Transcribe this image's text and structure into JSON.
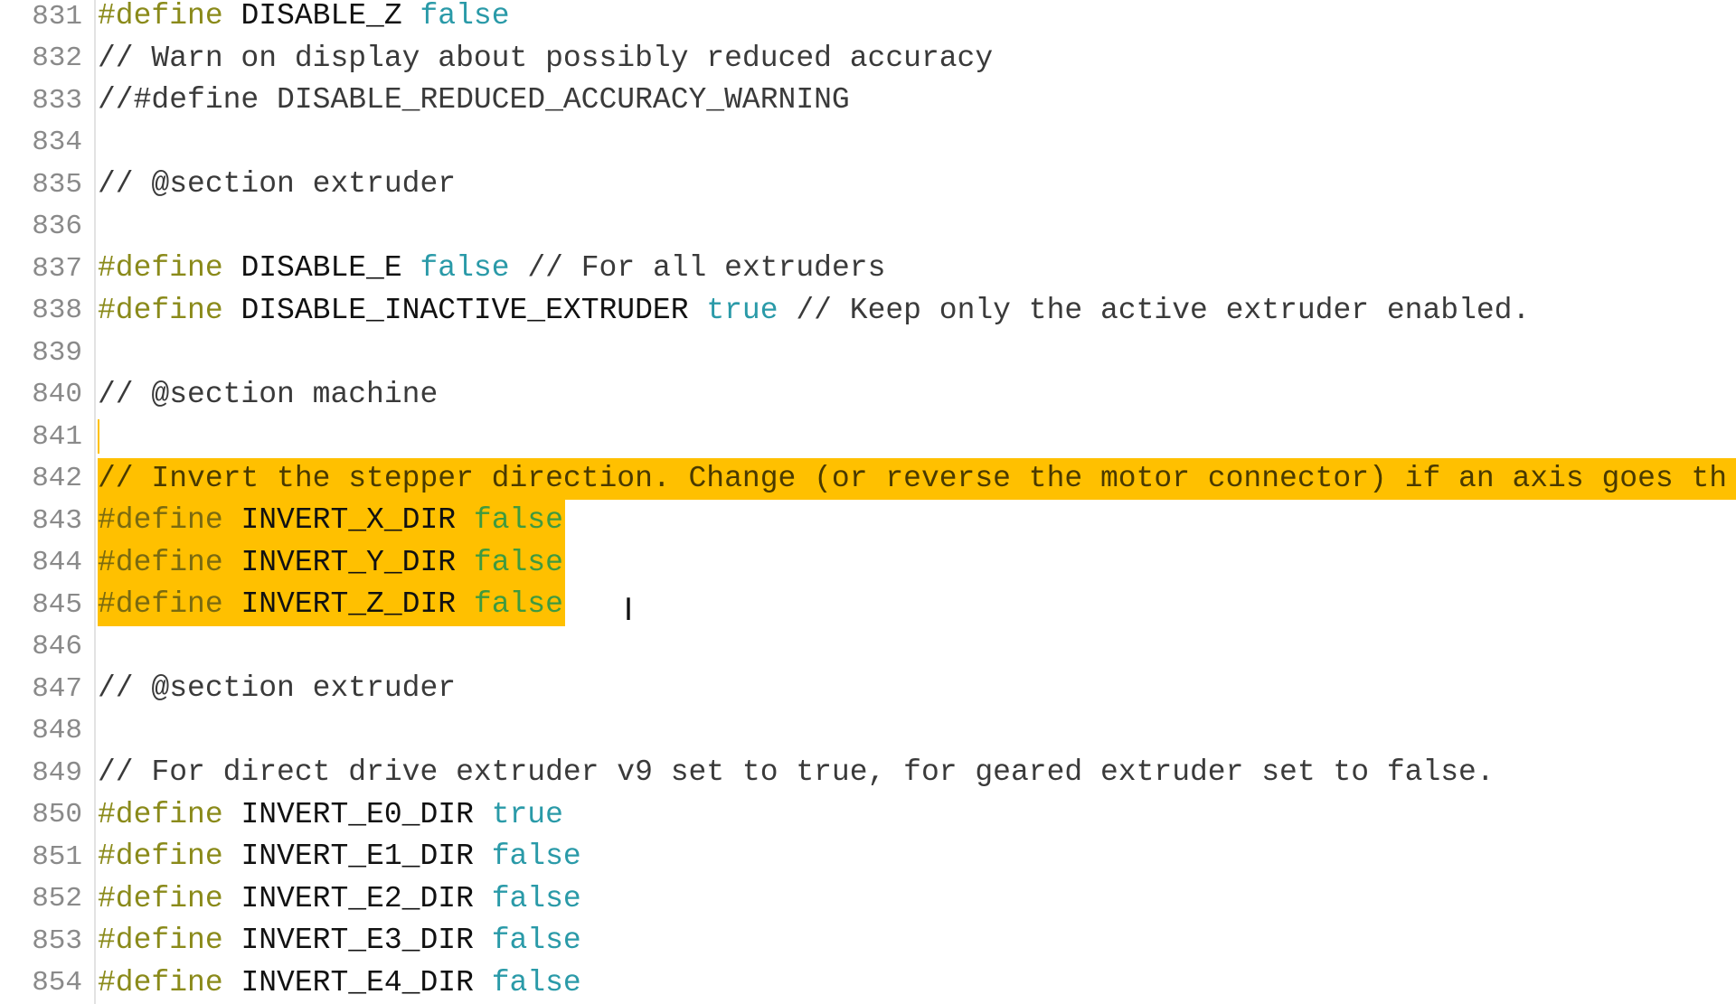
{
  "editor": {
    "selection_color": "#ffc000",
    "lines": [
      {
        "n": "831",
        "tokens": [
          {
            "t": "define",
            "v": "#define "
          },
          {
            "t": "ident",
            "v": "DISABLE_Z "
          },
          {
            "t": "bool",
            "v": "false"
          }
        ]
      },
      {
        "n": "832",
        "tokens": [
          {
            "t": "comment",
            "v": "// Warn on display about possibly reduced accuracy"
          }
        ]
      },
      {
        "n": "833",
        "tokens": [
          {
            "t": "comment",
            "v": "//#define DISABLE_REDUCED_ACCURACY_WARNING"
          }
        ]
      },
      {
        "n": "834",
        "tokens": []
      },
      {
        "n": "835",
        "tokens": [
          {
            "t": "comment",
            "v": "// @section extruder"
          }
        ]
      },
      {
        "n": "836",
        "tokens": []
      },
      {
        "n": "837",
        "tokens": [
          {
            "t": "define",
            "v": "#define "
          },
          {
            "t": "ident",
            "v": "DISABLE_E "
          },
          {
            "t": "bool",
            "v": "false"
          },
          {
            "t": "comment",
            "v": " // For all extruders"
          }
        ]
      },
      {
        "n": "838",
        "tokens": [
          {
            "t": "define",
            "v": "#define "
          },
          {
            "t": "ident",
            "v": "DISABLE_INACTIVE_EXTRUDER "
          },
          {
            "t": "bool",
            "v": "true"
          },
          {
            "t": "comment",
            "v": " // Keep only the active extruder enabled."
          }
        ]
      },
      {
        "n": "839",
        "tokens": []
      },
      {
        "n": "840",
        "tokens": [
          {
            "t": "comment",
            "v": "// @section machine"
          }
        ]
      },
      {
        "n": "841",
        "tokens": [],
        "caret": true
      },
      {
        "n": "842",
        "sel": "full",
        "tokens": [
          {
            "t": "comment",
            "v": "// Invert the stepper direction. Change (or reverse the motor connector) if an axis goes th"
          }
        ]
      },
      {
        "n": "843",
        "sel": "text",
        "tokens": [
          {
            "t": "define",
            "v": "#define "
          },
          {
            "t": "ident",
            "v": "INVERT_X_DIR "
          },
          {
            "t": "bool",
            "v": "false"
          }
        ]
      },
      {
        "n": "844",
        "sel": "text",
        "tokens": [
          {
            "t": "define",
            "v": "#define "
          },
          {
            "t": "ident",
            "v": "INVERT_Y_DIR "
          },
          {
            "t": "bool",
            "v": "false"
          }
        ]
      },
      {
        "n": "845",
        "sel": "text",
        "tokens": [
          {
            "t": "define",
            "v": "#define "
          },
          {
            "t": "ident",
            "v": "INVERT_Z_DIR "
          },
          {
            "t": "bool",
            "v": "false"
          }
        ]
      },
      {
        "n": "846",
        "tokens": []
      },
      {
        "n": "847",
        "tokens": [
          {
            "t": "comment",
            "v": "// @section extruder"
          }
        ]
      },
      {
        "n": "848",
        "tokens": []
      },
      {
        "n": "849",
        "tokens": [
          {
            "t": "comment",
            "v": "// For direct drive extruder v9 set to true, for geared extruder set to false."
          }
        ]
      },
      {
        "n": "850",
        "tokens": [
          {
            "t": "define",
            "v": "#define "
          },
          {
            "t": "ident",
            "v": "INVERT_E0_DIR "
          },
          {
            "t": "bool",
            "v": "true"
          }
        ]
      },
      {
        "n": "851",
        "tokens": [
          {
            "t": "define",
            "v": "#define "
          },
          {
            "t": "ident",
            "v": "INVERT_E1_DIR "
          },
          {
            "t": "bool",
            "v": "false"
          }
        ]
      },
      {
        "n": "852",
        "tokens": [
          {
            "t": "define",
            "v": "#define "
          },
          {
            "t": "ident",
            "v": "INVERT_E2_DIR "
          },
          {
            "t": "bool",
            "v": "false"
          }
        ]
      },
      {
        "n": "853",
        "tokens": [
          {
            "t": "define",
            "v": "#define "
          },
          {
            "t": "ident",
            "v": "INVERT_E3_DIR "
          },
          {
            "t": "bool",
            "v": "false"
          }
        ]
      },
      {
        "n": "854",
        "tokens": [
          {
            "t": "define",
            "v": "#define "
          },
          {
            "t": "ident",
            "v": "INVERT_E4_DIR "
          },
          {
            "t": "bool",
            "v": "false"
          }
        ]
      }
    ]
  },
  "cursor": {
    "icon": "text-ibeam-cursor",
    "glyph": "I"
  }
}
